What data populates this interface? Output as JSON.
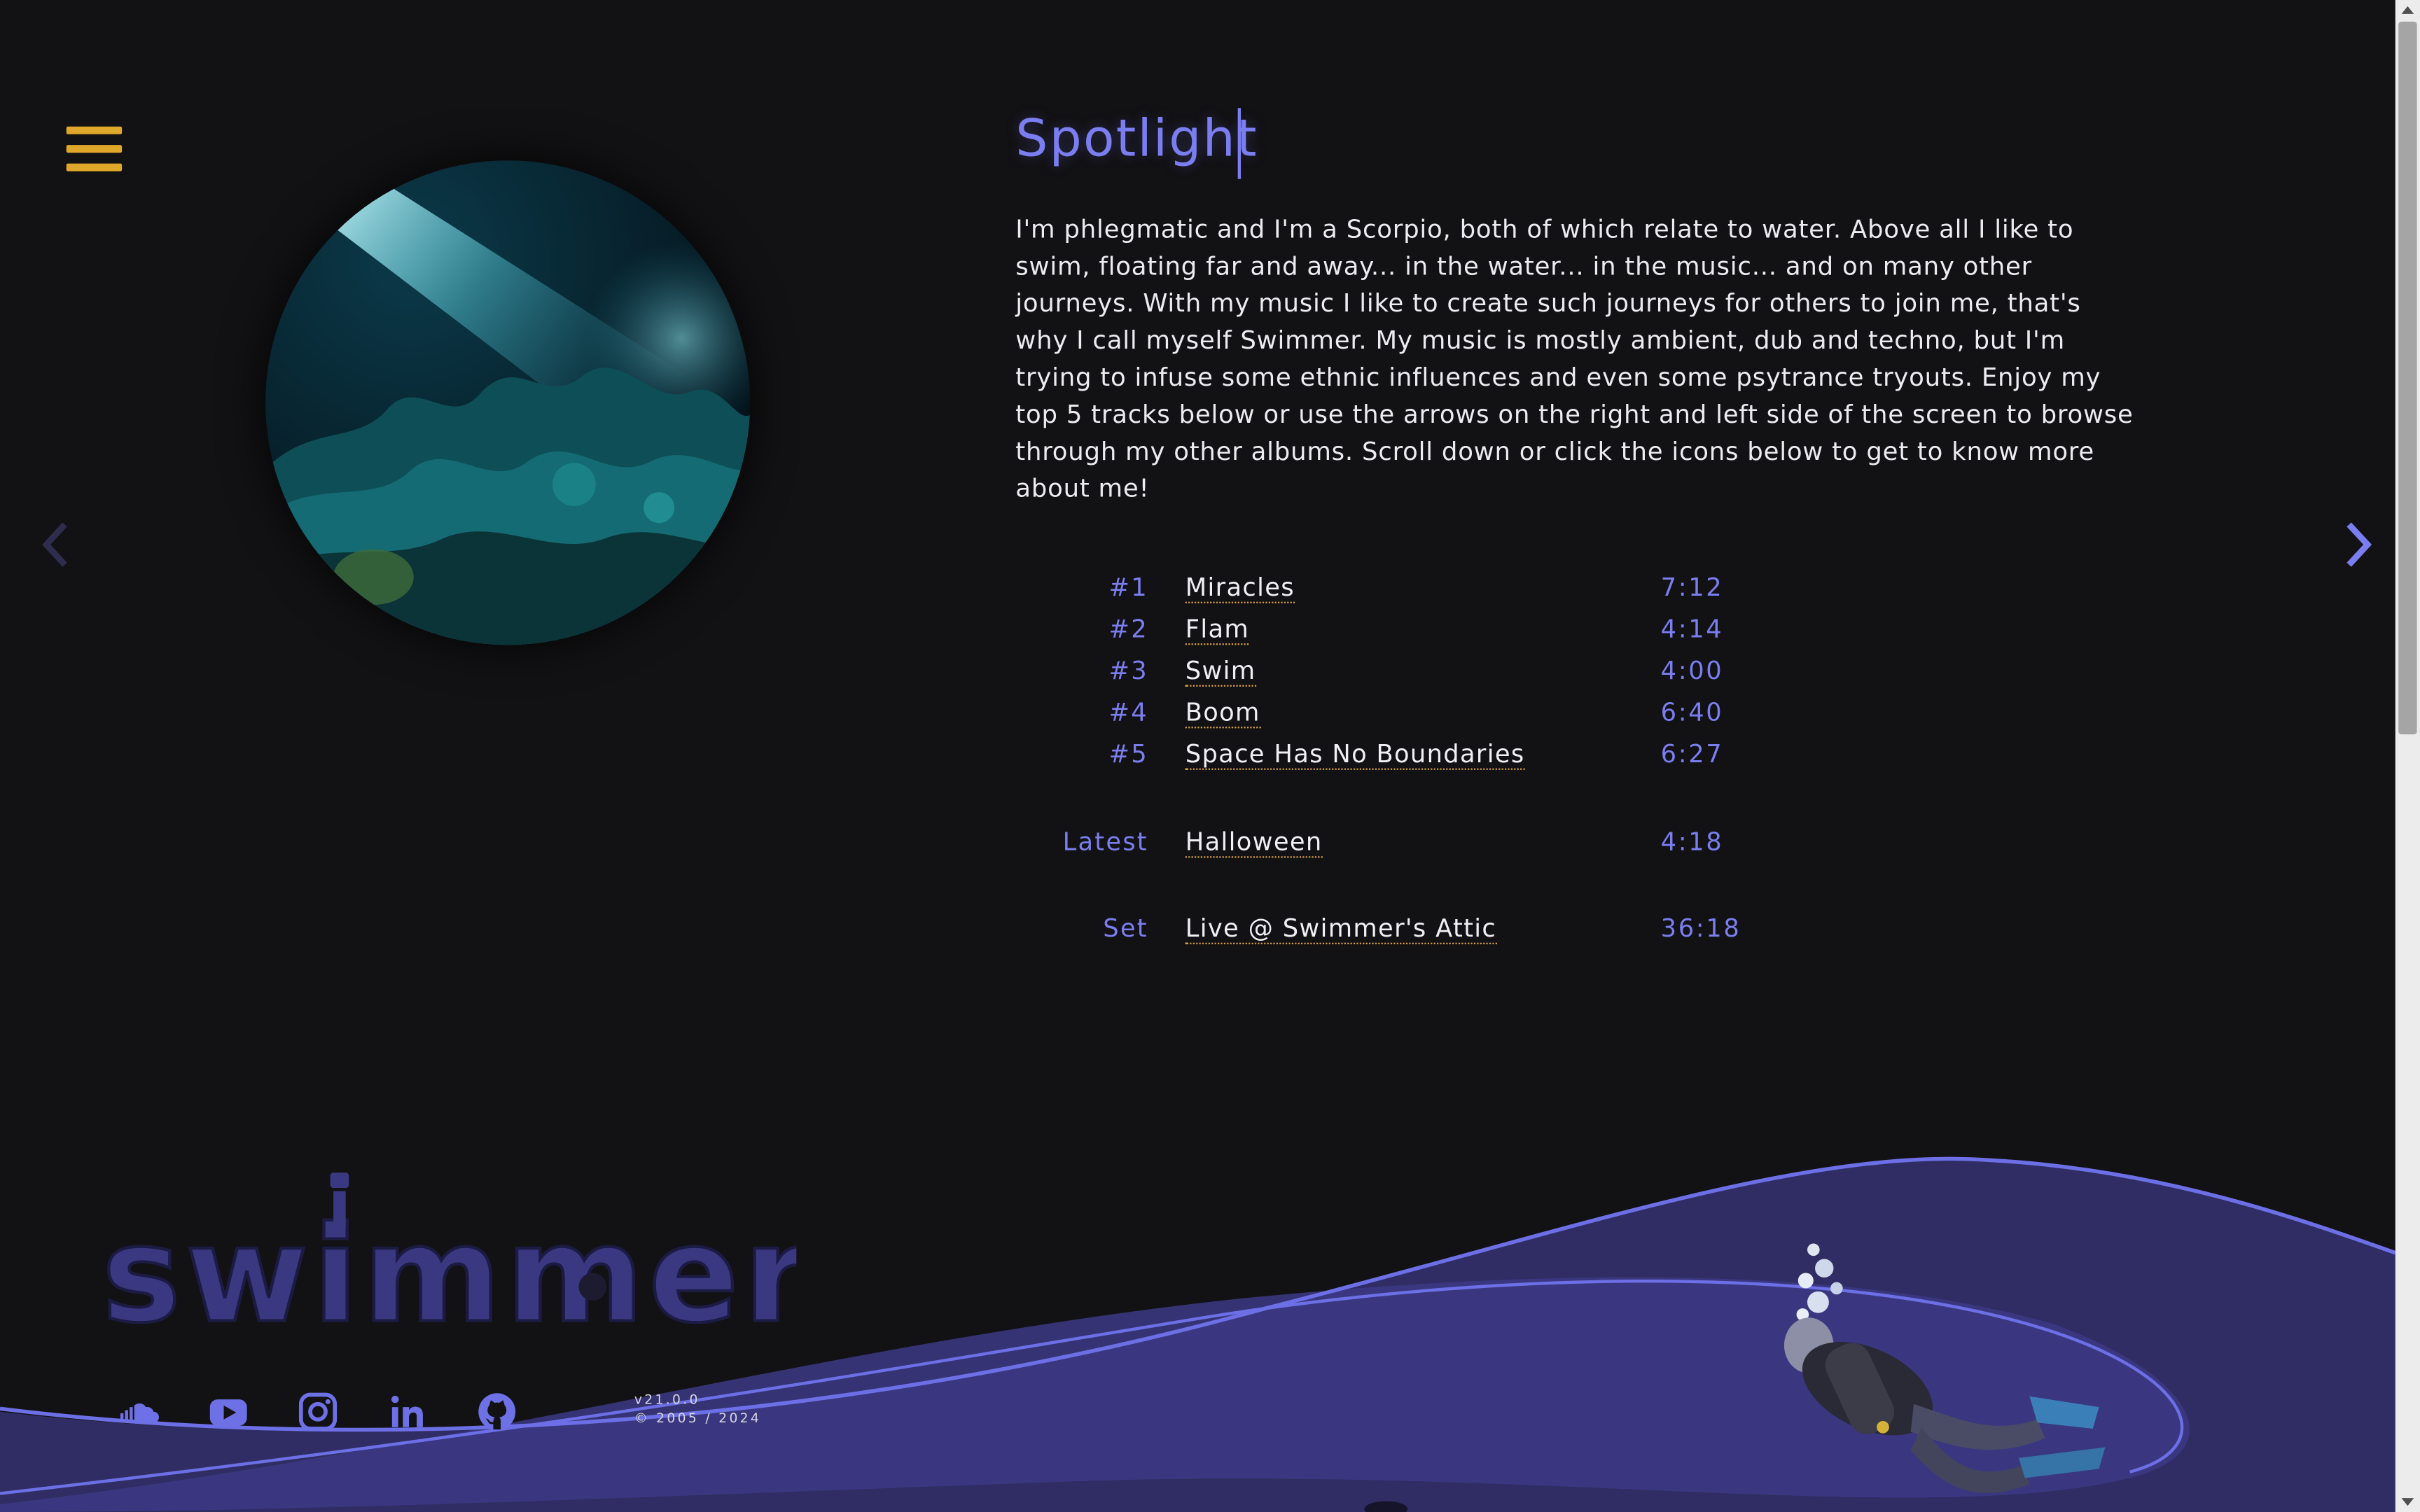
{
  "header": {
    "title": "Spotlight"
  },
  "bio": "I'm phlegmatic and I'm a Scorpio, both of which relate to water. Above all I like to swim, floating far and away... in the water... in the music... and on many other journeys. With my music I like to create such journeys for others to join me, that's why I call myself Swimmer. My music is mostly ambient, dub and techno, but I'm trying to infuse some ethnic influences and even some psytrance tryouts. Enjoy my top 5 tracks below or use the arrows on the right and left side of the screen to browse through my other albums. Scroll down or click the icons below to get to know more about me!",
  "tracks": [
    {
      "rank": "#1",
      "name": "Miracles",
      "duration": "7:12"
    },
    {
      "rank": "#2",
      "name": "Flam",
      "duration": "4:14"
    },
    {
      "rank": "#3",
      "name": "Swim",
      "duration": "4:00"
    },
    {
      "rank": "#4",
      "name": "Boom",
      "duration": "6:40"
    },
    {
      "rank": "#5",
      "name": "Space Has No Boundaries",
      "duration": "6:27"
    }
  ],
  "latest": {
    "label": "Latest",
    "name": "Halloween",
    "duration": "4:18"
  },
  "set": {
    "label": "Set",
    "name": "Live @ Swimmer's Attic",
    "duration": "36:18"
  },
  "logo": {
    "text": "swimmer"
  },
  "socials": [
    {
      "icon": "soundcloud-icon"
    },
    {
      "icon": "youtube-icon"
    },
    {
      "icon": "instagram-icon"
    },
    {
      "icon": "linkedin-icon"
    },
    {
      "icon": "github-icon"
    }
  ],
  "footer": {
    "version": "v21.0.0",
    "copyright": "© 2005 / 2024"
  },
  "colors": {
    "accent": "#7b7ef0",
    "menu": "#e0a82a",
    "background": "#121113",
    "wave": "#3d3b85"
  }
}
